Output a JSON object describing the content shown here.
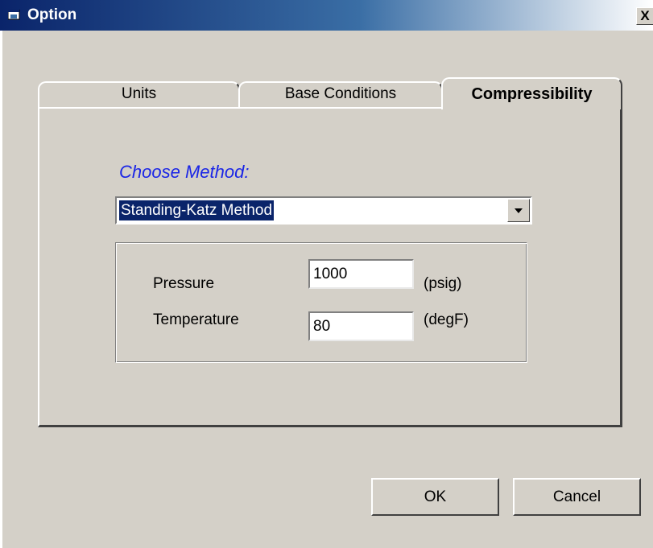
{
  "window": {
    "title": "Option",
    "close_label": "X",
    "icon": "app-window-icon"
  },
  "tabs": [
    {
      "label": "Units",
      "active": false
    },
    {
      "label": "Base Conditions",
      "active": false
    },
    {
      "label": "Compressibility",
      "active": true
    }
  ],
  "compressibility": {
    "choose_label": "Choose Method:",
    "method_value": "Standing-Katz Method",
    "dropdown_icon": "chevron-down-icon",
    "fields": [
      {
        "label": "Pressure",
        "value": "1000",
        "unit": "(psig)"
      },
      {
        "label": "Temperature",
        "value": "80",
        "unit": "(degF)"
      }
    ]
  },
  "buttons": {
    "ok": "OK",
    "cancel": "Cancel"
  },
  "colors": {
    "titlebar_start": "#0a246a",
    "titlebar_end": "#ffffff",
    "label_accent": "#1a25e6",
    "selection": "#0a246a",
    "face": "#d4d0c8"
  }
}
